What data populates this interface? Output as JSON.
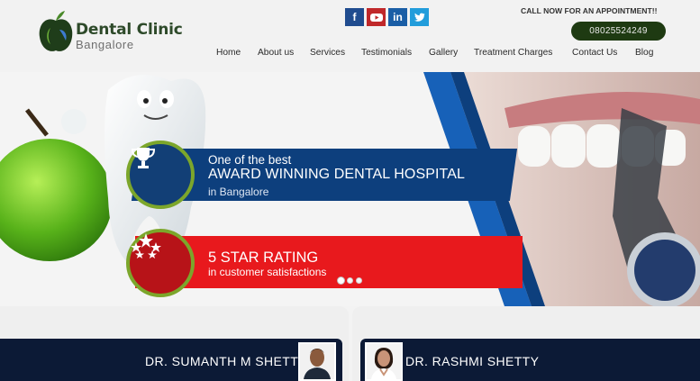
{
  "brand": {
    "name": "Dental Clinic",
    "city": "Bangalore",
    "accent": "#1e3a12"
  },
  "social": {
    "facebook": "f",
    "youtube_icon": "youtube-icon",
    "linkedin": "in",
    "twitter_icon": "twitter-icon"
  },
  "contact": {
    "call_text": "CALL NOW FOR AN APPOINTMENT!!",
    "phone": "08025524249"
  },
  "nav": {
    "items": [
      {
        "label": "Home"
      },
      {
        "label": "About us"
      },
      {
        "label": "Services"
      },
      {
        "label": "Testimonials"
      },
      {
        "label": "Gallery"
      },
      {
        "label": "Treatment Charges"
      },
      {
        "label": "Contact Us"
      },
      {
        "label": "Blog"
      }
    ]
  },
  "banner": {
    "award": {
      "line1": "One of the best",
      "line2": "AWARD WINNING DENTAL HOSPITAL",
      "line3": "in Bangalore",
      "icon": "trophy-icon"
    },
    "rating": {
      "line1": "5 STAR RATING",
      "line2": "in customer satisfactions",
      "icon": "stars-icon"
    },
    "slides": {
      "count": 3,
      "active": 1
    },
    "colors": {
      "blue": "#0d3f7d",
      "red": "#e8191d",
      "green": "#7ca62b"
    }
  },
  "doctors": [
    {
      "name": "DR. SUMANTH M SHETTY"
    },
    {
      "name": "DR. RASHMI SHETTY"
    }
  ]
}
